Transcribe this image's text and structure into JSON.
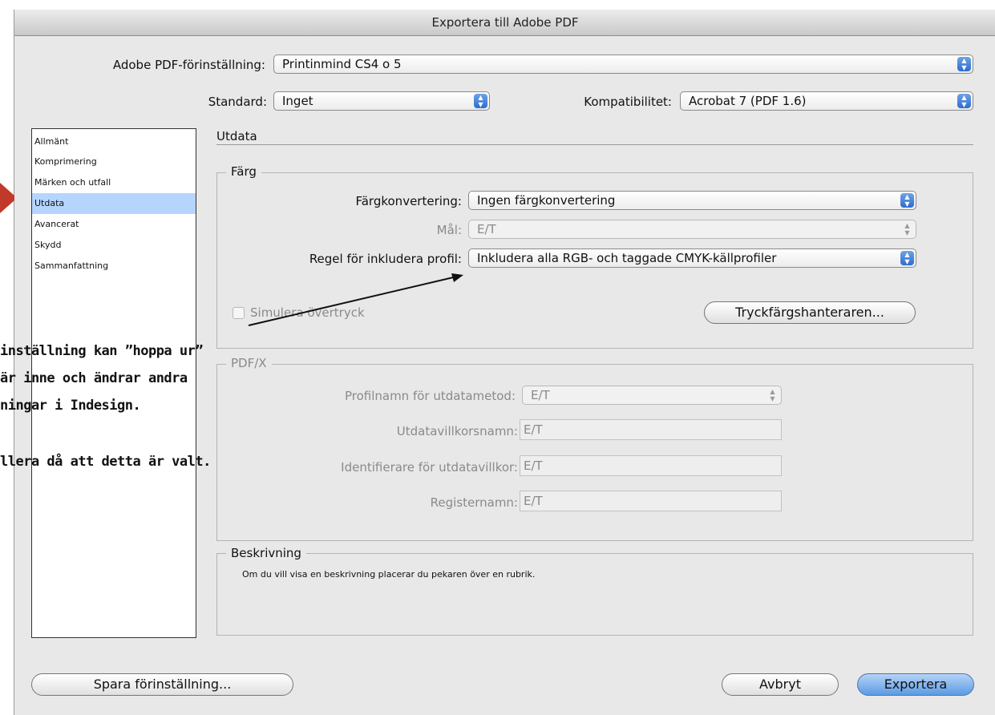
{
  "window": {
    "title": "Exportera till Adobe PDF"
  },
  "preset": {
    "label": "Adobe PDF-förinställning:",
    "value": "Printinmind CS4 o 5"
  },
  "standard": {
    "label": "Standard:",
    "value": "Inget"
  },
  "compat": {
    "label": "Kompatibilitet:",
    "value": "Acrobat 7 (PDF 1.6)"
  },
  "sidebar": {
    "items": [
      {
        "label": "Allmänt"
      },
      {
        "label": "Komprimering"
      },
      {
        "label": "Märken och utfall"
      },
      {
        "label": "Utdata"
      },
      {
        "label": "Avancerat"
      },
      {
        "label": "Skydd"
      },
      {
        "label": "Sammanfattning"
      }
    ],
    "selected": "Utdata"
  },
  "panel": {
    "title": "Utdata"
  },
  "color": {
    "group_label": "Färg",
    "conversion": {
      "label": "Färgkonvertering:",
      "value": "Ingen färgkonvertering"
    },
    "target": {
      "label": "Mål:",
      "value": "E/T"
    },
    "profile_rule": {
      "label": "Regel för inkludera profil:",
      "value": "Inkludera alla RGB- och taggade CMYK-källprofiler"
    },
    "simulate_overprint": {
      "label": "Simulera övertryck",
      "checked": false
    },
    "ink_manager_button": "Tryckfärgshanteraren..."
  },
  "pdfx": {
    "group_label": "PDF/X",
    "output_profile": {
      "label": "Profilnamn för utdatametod:",
      "value": "E/T"
    },
    "condition_name": {
      "label": "Utdatavillkorsnamn:",
      "value": "E/T"
    },
    "condition_id": {
      "label": "Identifierare för utdatavillkor:",
      "value": "E/T"
    },
    "registry_name": {
      "label": "Registernamn:",
      "value": "E/T"
    }
  },
  "description": {
    "group_label": "Beskrivning",
    "text": "Om du vill visa en beskrivning placerar du pekaren över en rubrik."
  },
  "buttons": {
    "save_preset": "Spara förinställning...",
    "cancel": "Avbryt",
    "export": "Exportera"
  },
  "annotation": {
    "lines": [
      "inställning kan ”hoppa ur”",
      "är inne och ändrar andra",
      "ningar i Indesign.",
      "",
      "llera då att detta är valt."
    ]
  },
  "colors": {
    "selection": "#b5d5ff",
    "annotation_arrow": "#c0392b",
    "accent_blue": "#2d6cd1"
  }
}
